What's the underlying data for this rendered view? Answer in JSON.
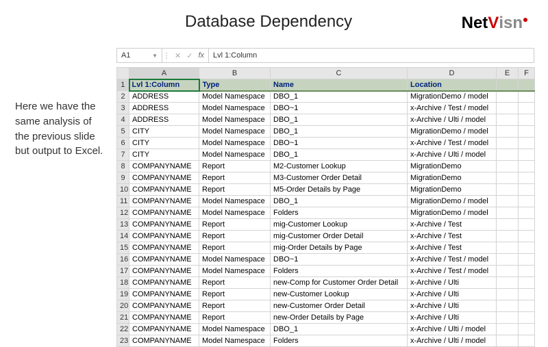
{
  "title": "Database Dependency",
  "logo": {
    "part1": "Net",
    "part2": "V",
    "part3": "isn"
  },
  "blurb": "Here we have the same analysis of the previous slide but output to Excel.",
  "formula_bar": {
    "cell_ref": "A1",
    "value": "Lvl 1:Column"
  },
  "columns": [
    "A",
    "B",
    "C",
    "D",
    "E",
    "F"
  ],
  "headers": {
    "A": "Lvl 1:Column",
    "B": "Type",
    "C": "Name",
    "D": "Location"
  },
  "rows": [
    {
      "n": "2",
      "A": "ADDRESS",
      "B": "Model Namespace",
      "C": "DBO_1",
      "D": "MigrationDemo / model"
    },
    {
      "n": "3",
      "A": "ADDRESS",
      "B": "Model Namespace",
      "C": "DBO~1",
      "D": "x-Archive / Test / model"
    },
    {
      "n": "4",
      "A": "ADDRESS",
      "B": "Model Namespace",
      "C": "DBO_1",
      "D": "x-Archive / Ulti / model"
    },
    {
      "n": "5",
      "A": "CITY",
      "B": "Model Namespace",
      "C": "DBO_1",
      "D": "MigrationDemo / model"
    },
    {
      "n": "6",
      "A": "CITY",
      "B": "Model Namespace",
      "C": "DBO~1",
      "D": "x-Archive / Test / model"
    },
    {
      "n": "7",
      "A": "CITY",
      "B": "Model Namespace",
      "C": "DBO_1",
      "D": "x-Archive / Ulti / model"
    },
    {
      "n": "8",
      "A": "COMPANYNAME",
      "B": "Report",
      "C": "M2-Customer Lookup",
      "D": "MigrationDemo"
    },
    {
      "n": "9",
      "A": "COMPANYNAME",
      "B": "Report",
      "C": "M3-Customer Order Detail",
      "D": "MigrationDemo"
    },
    {
      "n": "10",
      "A": "COMPANYNAME",
      "B": "Report",
      "C": "M5-Order Details by Page",
      "D": "MigrationDemo"
    },
    {
      "n": "11",
      "A": "COMPANYNAME",
      "B": "Model Namespace",
      "C": "DBO_1",
      "D": "MigrationDemo / model"
    },
    {
      "n": "12",
      "A": "COMPANYNAME",
      "B": "Model Namespace",
      "C": "Folders",
      "D": "MigrationDemo / model"
    },
    {
      "n": "13",
      "A": "COMPANYNAME",
      "B": "Report",
      "C": "mig-Customer Lookup",
      "D": "x-Archive / Test"
    },
    {
      "n": "14",
      "A": "COMPANYNAME",
      "B": "Report",
      "C": "mig-Customer Order Detail",
      "D": "x-Archive / Test"
    },
    {
      "n": "15",
      "A": "COMPANYNAME",
      "B": "Report",
      "C": "mig-Order Details by Page",
      "D": "x-Archive / Test"
    },
    {
      "n": "16",
      "A": "COMPANYNAME",
      "B": "Model Namespace",
      "C": "DBO~1",
      "D": "x-Archive / Test / model"
    },
    {
      "n": "17",
      "A": "COMPANYNAME",
      "B": "Model Namespace",
      "C": "Folders",
      "D": "x-Archive / Test / model"
    },
    {
      "n": "18",
      "A": "COMPANYNAME",
      "B": "Report",
      "C": "new-Comp for Customer Order Detail",
      "D": "x-Archive / Ulti"
    },
    {
      "n": "19",
      "A": "COMPANYNAME",
      "B": "Report",
      "C": "new-Customer Lookup",
      "D": "x-Archive / Ulti"
    },
    {
      "n": "20",
      "A": "COMPANYNAME",
      "B": "Report",
      "C": "new-Customer Order Detail",
      "D": "x-Archive / Ulti"
    },
    {
      "n": "21",
      "A": "COMPANYNAME",
      "B": "Report",
      "C": "new-Order Details by Page",
      "D": "x-Archive / Ulti"
    },
    {
      "n": "22",
      "A": "COMPANYNAME",
      "B": "Model Namespace",
      "C": "DBO_1",
      "D": "x-Archive / Ulti / model"
    },
    {
      "n": "23",
      "A": "COMPANYNAME",
      "B": "Model Namespace",
      "C": "Folders",
      "D": "x-Archive / Ulti / model"
    }
  ]
}
